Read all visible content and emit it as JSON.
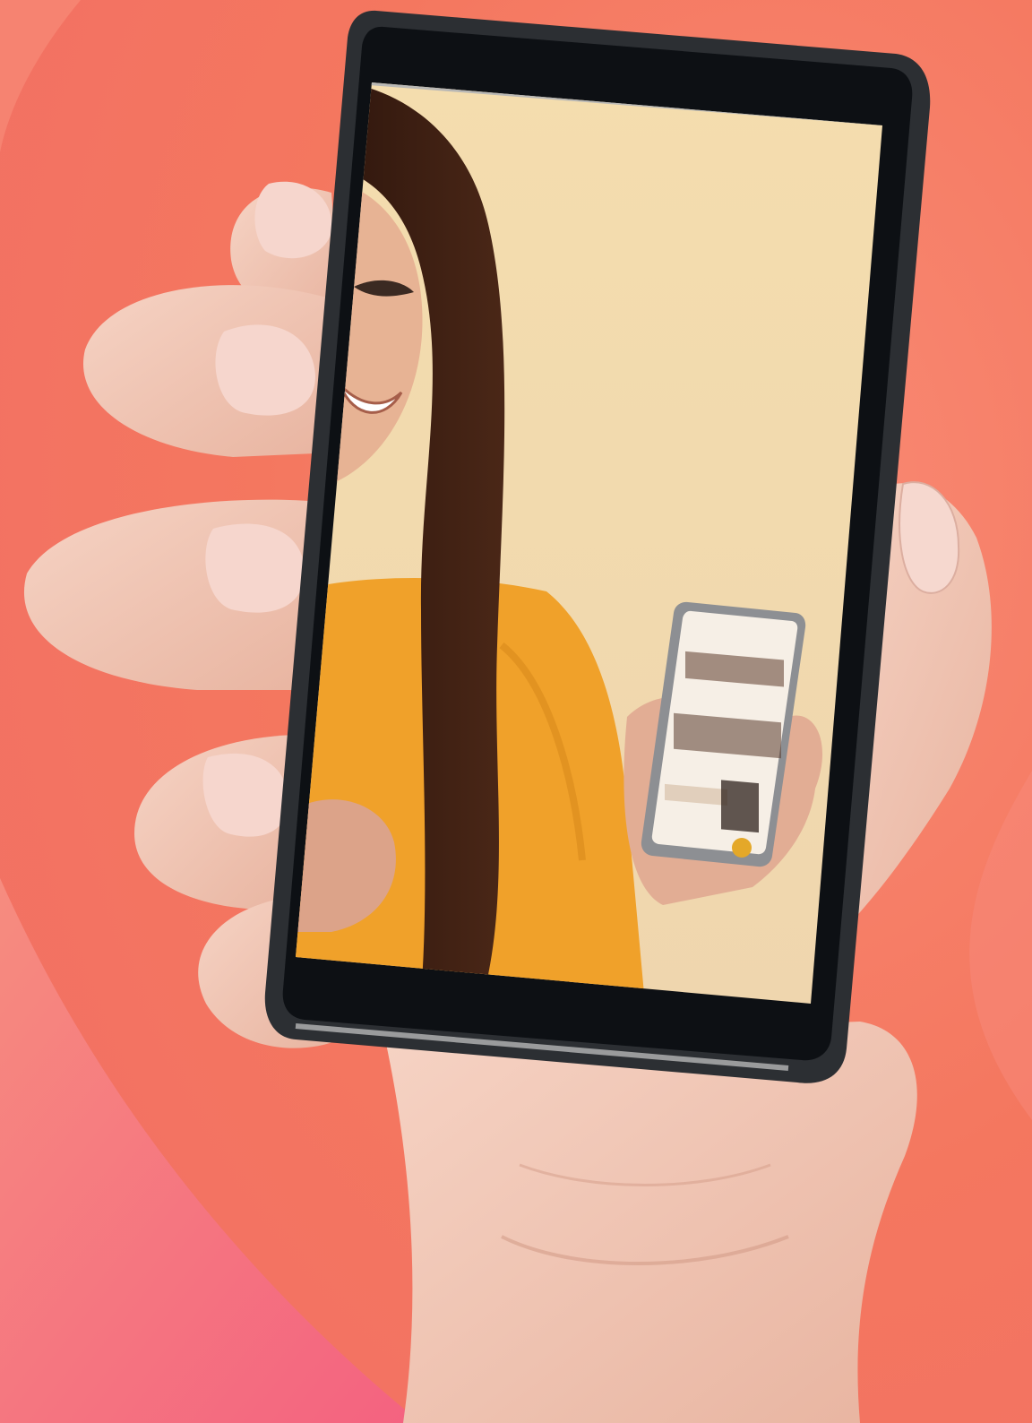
{
  "scene": {
    "description_free": true,
    "colors": {
      "background_coral": "#f47a6a",
      "background_pink": "#f56c86",
      "background_light": "#f9917c",
      "skin": "#f2c9b8",
      "skin_shadow": "#d9a08c",
      "nail": "#f6d6d0",
      "phone_case": "#2c2f33",
      "phone_bezel": "#0d1014",
      "screen_wall": "#f1d8a6",
      "screen_top": "#b9b8b5",
      "shirt": "#f0a12a",
      "hair": "#3a1d12",
      "inner_phone_screen": "#f6efe6"
    },
    "icons": {
      "small_phone": "smartphone-icon",
      "inner_app_logo": "badge-icon"
    }
  }
}
